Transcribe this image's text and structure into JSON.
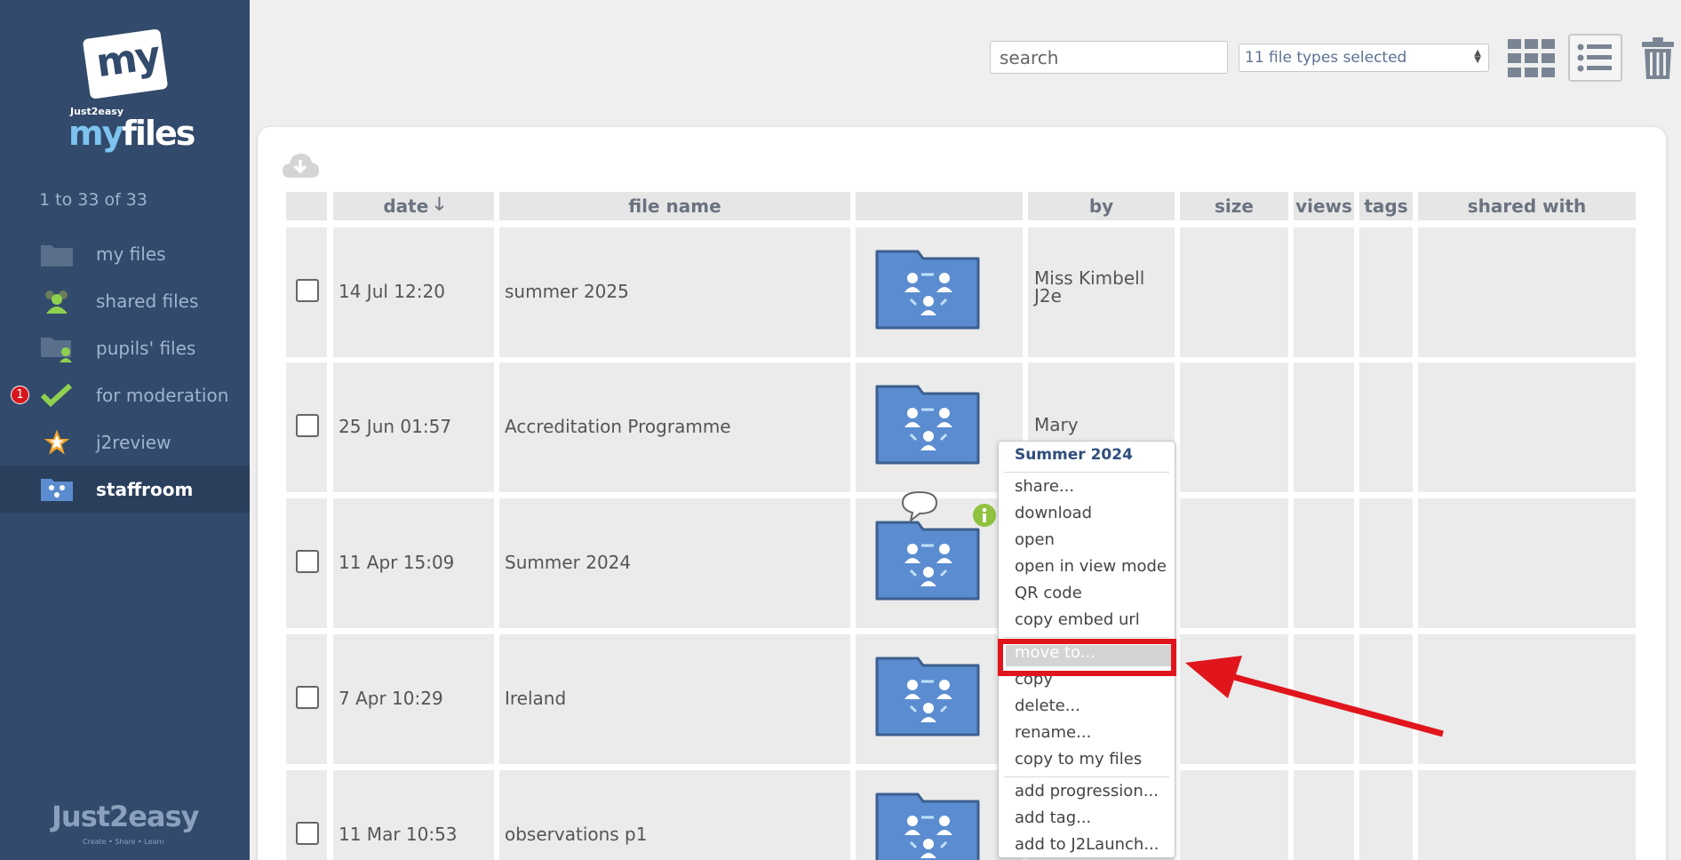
{
  "logo": {
    "card_text": "my",
    "brand_small": "Just2easy",
    "brand_my": "my",
    "brand_files": "files"
  },
  "sidebar": {
    "count": "1 to 33 of 33",
    "items": [
      {
        "label": "my files",
        "icon": "folder-icon"
      },
      {
        "label": "shared files",
        "icon": "people-icon"
      },
      {
        "label": "pupils' files",
        "icon": "pupil-folder-icon"
      },
      {
        "label": "for moderation",
        "icon": "checkmark-icon",
        "badge": "1"
      },
      {
        "label": "j2review",
        "icon": "star-icon"
      },
      {
        "label": "staffroom",
        "icon": "staffroom-icon",
        "active": true
      }
    ],
    "footer_logo": "Just2easy",
    "footer_tag": "Create • Share • Learn"
  },
  "toolbar": {
    "search_placeholder": "search",
    "file_types": "11 file types selected"
  },
  "table": {
    "headers": {
      "date": "date",
      "date_sort": "🡓",
      "file_name": "file name",
      "by": "by",
      "size": "size",
      "views": "views",
      "tags": "tags",
      "shared_with": "shared with"
    },
    "rows": [
      {
        "date": "14 Jul 12:20",
        "name": "summer 2025",
        "by": "Miss Kimbell J2e"
      },
      {
        "date": "25 Jun 01:57",
        "name": "Accreditation Programme",
        "by": "Mary"
      },
      {
        "date": "11 Apr 15:09",
        "name": "Summer 2024",
        "by": ""
      },
      {
        "date": "7 Apr 10:29",
        "name": "Ireland",
        "by": ""
      },
      {
        "date": "11 Mar 10:53",
        "name": "observations p1",
        "by": ""
      }
    ]
  },
  "context_menu": {
    "title": "Summer 2024",
    "items": [
      "share...",
      "download",
      "open",
      "open in view mode",
      "QR code",
      "copy embed url",
      "move to...",
      "copy",
      "delete...",
      "rename...",
      "copy to my files",
      "add progression...",
      "add tag...",
      "add to J2Launch..."
    ]
  },
  "colors": {
    "sidebar": "#324a6b",
    "folder": "#5b8ccf",
    "highlight": "#e0161c"
  }
}
